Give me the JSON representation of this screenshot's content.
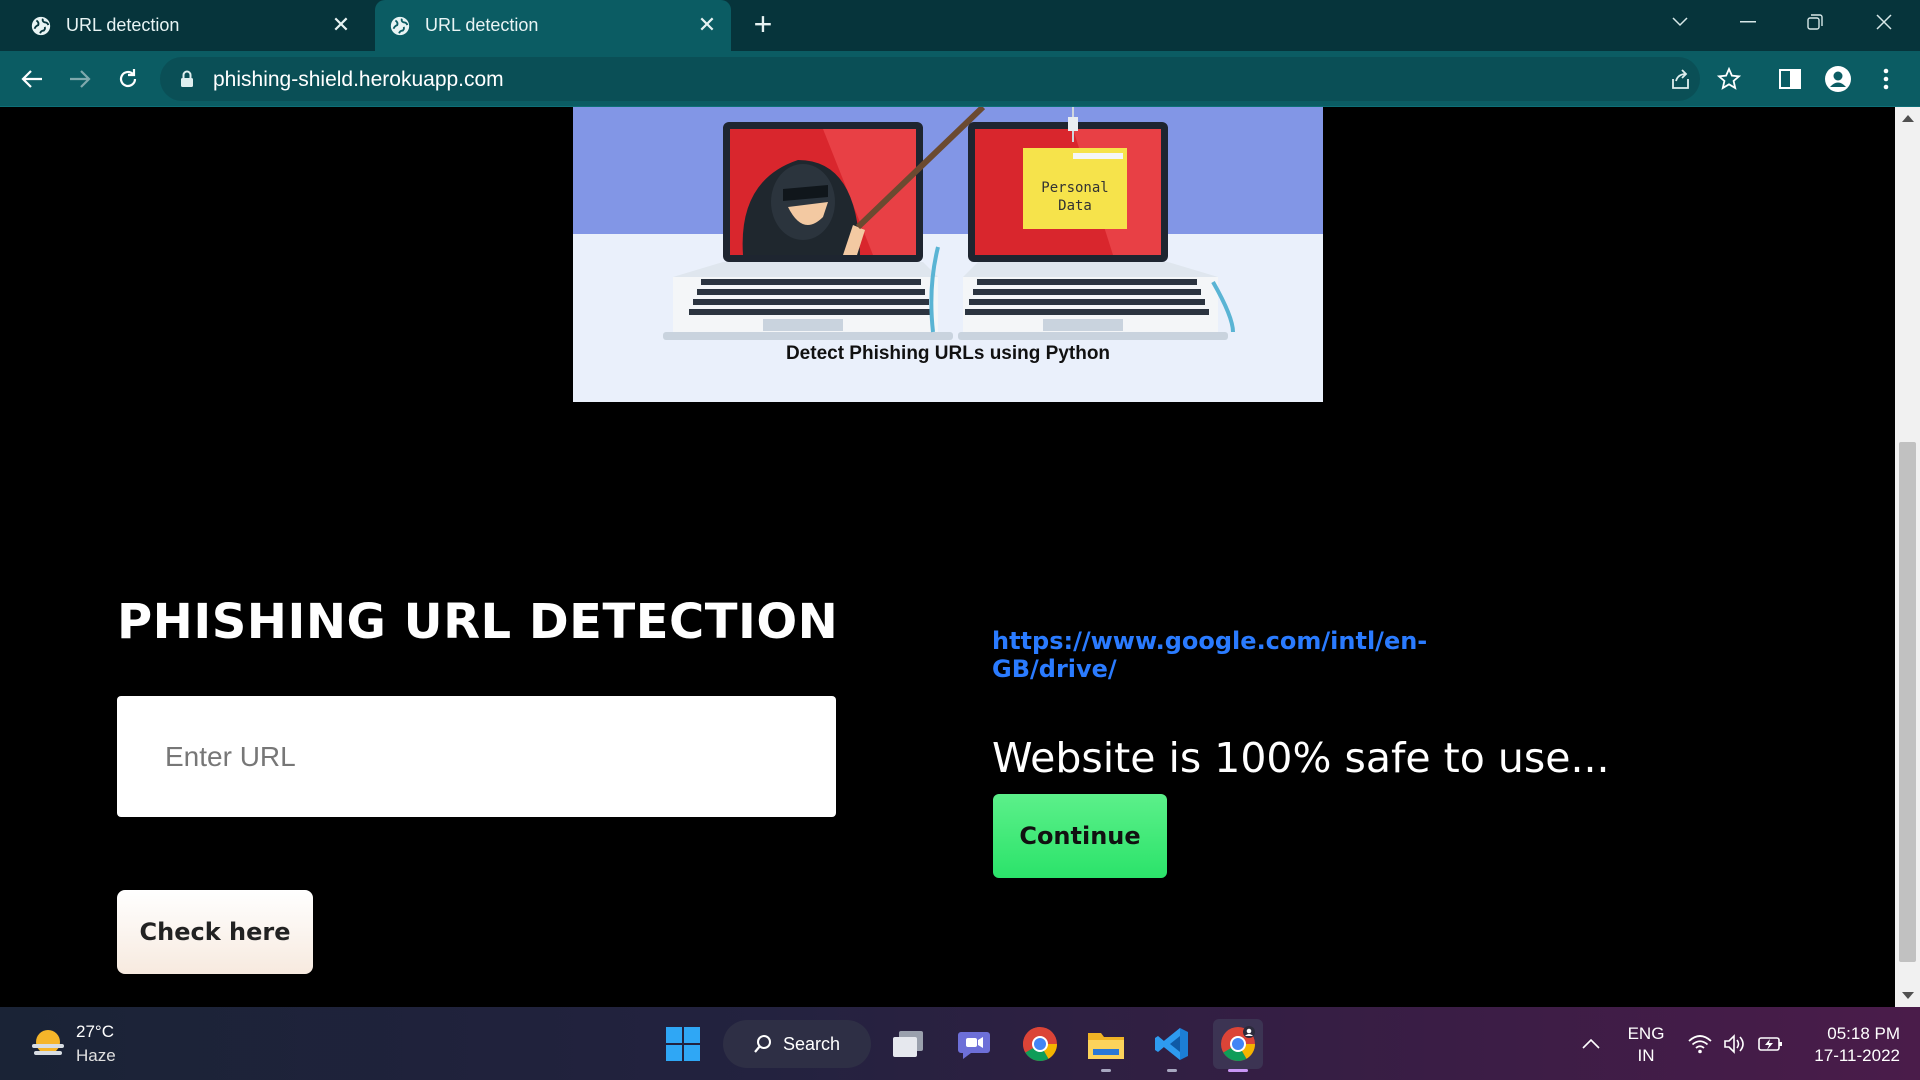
{
  "browser": {
    "tabs": [
      {
        "title": "URL detection",
        "active": false
      },
      {
        "title": "URL detection",
        "active": true
      }
    ],
    "address": "phishing-shield.herokuapp.com"
  },
  "page": {
    "hero_caption": "Detect Phishing URLs using Python",
    "hero_folder_text_line1": "Personal",
    "hero_folder_text_line2": "Data",
    "heading": "PHISHING URL DETECTION",
    "input_placeholder": "Enter URL",
    "check_button": "Check here",
    "result_link": "https://www.google.com/intl/en-GB/drive/",
    "result_message": "Website is 100% safe to use...",
    "continue_button": "Continue"
  },
  "taskbar": {
    "weather_temp": "27°C",
    "weather_cond": "Haze",
    "search_label": "Search",
    "lang_line1": "ENG",
    "lang_line2": "IN",
    "time": "05:18 PM",
    "date": "17-11-2022"
  },
  "colors": {
    "chrome_dark": "#06343b",
    "chrome_toolbar": "#0b5c63",
    "link_blue": "#2a7bff",
    "continue_green": "#2be36a"
  }
}
